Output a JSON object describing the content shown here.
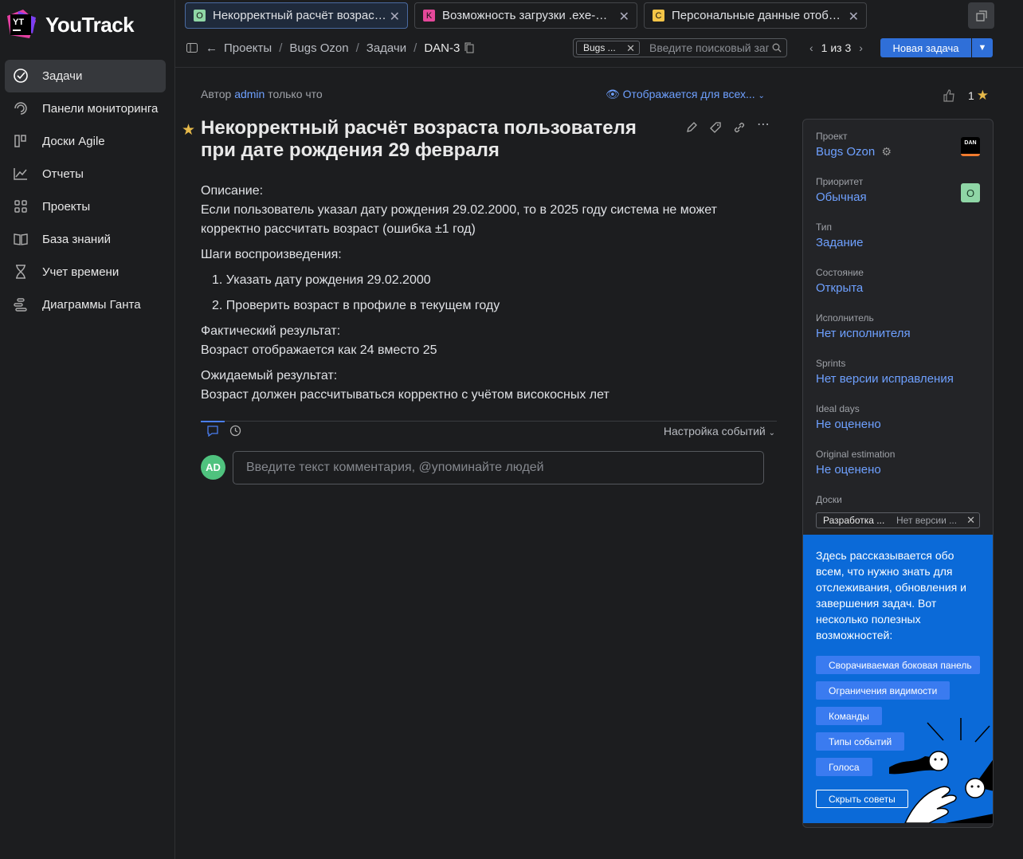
{
  "app": {
    "name": "YouTrack"
  },
  "nav": [
    {
      "label": "Задачи",
      "active": true,
      "icon": "check-circle-icon"
    },
    {
      "label": "Панели мониторинга",
      "icon": "dashboard-icon"
    },
    {
      "label": "Доски Agile",
      "icon": "board-icon"
    },
    {
      "label": "Отчеты",
      "icon": "chart-icon"
    },
    {
      "label": "Проекты",
      "icon": "grid-icon"
    },
    {
      "label": "База знаний",
      "icon": "book-icon"
    },
    {
      "label": "Учет времени",
      "icon": "hourglass-icon"
    },
    {
      "label": "Диаграммы Ганта",
      "icon": "gantt-icon"
    }
  ],
  "tabs": [
    {
      "badge": "O",
      "badge_color": "#8fd6a6",
      "title": "Некорректный расчёт возраста пользователя",
      "active": true
    },
    {
      "badge": "K",
      "badge_color": "#e5489a",
      "title": "Возможность загрузки .exe-файлов"
    },
    {
      "badge": "C",
      "badge_color": "#f3c447",
      "title": "Персональные данные отображаются"
    }
  ],
  "breadcrumbs": [
    "Проекты",
    "Bugs Ozon",
    "Задачи",
    "DAN-3"
  ],
  "search": {
    "chip": "Bugs ...",
    "placeholder": "Введите поисковый запрос"
  },
  "pager": {
    "text": "1 из 3"
  },
  "new_issue": {
    "label": "Новая задача"
  },
  "issue": {
    "author_prefix": "Автор",
    "author": "admin",
    "time": "только что",
    "visibility": "Отображается для всех...",
    "votes": "1",
    "title": "Некорректный расчёт возраста пользователя при дате рождения 29 февраля",
    "desc_label": "Описание:",
    "desc_text": "Если пользователь указал дату рождения 29.02.2000, то в 2025 году система не может корректно рассчитать возраст (ошибка ±1 год)",
    "steps_label": "Шаги воспроизведения:",
    "steps": [
      "1. Указать дату рождения 29.02.2000",
      "2. Проверить возраст в профиле в текущем году"
    ],
    "actual_label": "Фактический результат:",
    "actual_text": "Возраст отображается как 24 вместо 25",
    "expected_label": "Ожидаемый результат:",
    "expected_text": "Возраст должен рассчитываться корректно с учётом високосных лет"
  },
  "activity": {
    "events_label": "Настройка событий"
  },
  "comment": {
    "avatar": "AD",
    "placeholder": "Введите текст комментария, @упоминайте людей"
  },
  "fields": [
    {
      "label": "Проект",
      "value": "Bugs Ozon"
    },
    {
      "label": "Приоритет",
      "value": "Обычная"
    },
    {
      "label": "Тип",
      "value": "Задание"
    },
    {
      "label": "Состояние",
      "value": "Открыта"
    },
    {
      "label": "Исполнитель",
      "value": "Нет исполнителя"
    },
    {
      "label": "Sprints",
      "value": "Нет версии исправления"
    },
    {
      "label": "Ideal days",
      "value": "Не оценено"
    },
    {
      "label": "Original estimation",
      "value": "Не оценено"
    },
    {
      "label": "Доски",
      "value": ""
    }
  ],
  "project_avatar": "DAN",
  "priority_badge": "О",
  "boards": {
    "board": "Разработка ...",
    "sprint": "Нет версии ..."
  },
  "tips": {
    "text": "Здесь рассказывается обо всем, что нужно знать для отслеживания, обновления и завершения задач. Вот несколько полезных возможностей:",
    "links": [
      "Сворачиваемая боковая панель",
      "Ограничения видимости",
      "Команды",
      "Типы событий",
      "Голоса"
    ],
    "hide": "Скрыть советы"
  }
}
